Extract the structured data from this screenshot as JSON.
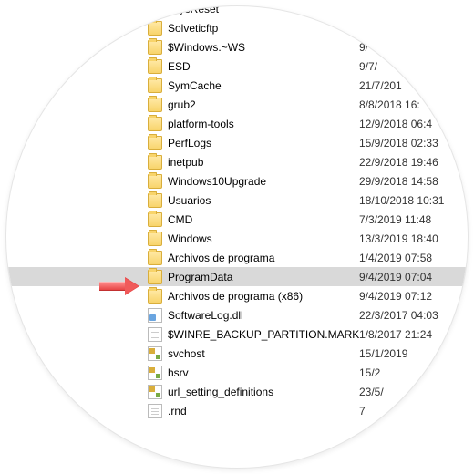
{
  "items": [
    {
      "icon": "folder",
      "name": "..sysReset",
      "date": ""
    },
    {
      "icon": "folder",
      "name": "Solveticftp",
      "date": ""
    },
    {
      "icon": "folder",
      "name": "$Windows.~WS",
      "date": "9/"
    },
    {
      "icon": "folder",
      "name": "ESD",
      "date": "9/7/"
    },
    {
      "icon": "folder",
      "name": "SymCache",
      "date": "21/7/201"
    },
    {
      "icon": "folder",
      "name": "grub2",
      "date": "8/8/2018 16:"
    },
    {
      "icon": "folder",
      "name": "platform-tools",
      "date": "12/9/2018 06:4"
    },
    {
      "icon": "folder",
      "name": "PerfLogs",
      "date": "15/9/2018 02:33"
    },
    {
      "icon": "folder",
      "name": "inetpub",
      "date": "22/9/2018 19:46"
    },
    {
      "icon": "folder",
      "name": "Windows10Upgrade",
      "date": "29/9/2018 14:58"
    },
    {
      "icon": "folder",
      "name": "Usuarios",
      "date": "18/10/2018 10:31"
    },
    {
      "icon": "folder",
      "name": "CMD",
      "date": "7/3/2019 11:48"
    },
    {
      "icon": "folder",
      "name": "Windows",
      "date": "13/3/2019 18:40"
    },
    {
      "icon": "folder",
      "name": "Archivos de programa",
      "date": "1/4/2019 07:58"
    },
    {
      "icon": "folder",
      "name": "ProgramData",
      "date": "9/4/2019 07:04",
      "selected": true
    },
    {
      "icon": "folder",
      "name": "Archivos de programa (x86)",
      "date": "9/4/2019 07:12"
    },
    {
      "icon": "dll",
      "name": "SoftwareLog.dll",
      "date": "22/3/2017 04:03"
    },
    {
      "icon": "file",
      "name": "$WINRE_BACKUP_PARTITION.MARKER",
      "date": "1/8/2017 21:24"
    },
    {
      "icon": "ini",
      "name": "svchost",
      "date": "15/1/2019"
    },
    {
      "icon": "ini",
      "name": "hsrv",
      "date": "15/2"
    },
    {
      "icon": "ini",
      "name": "url_setting_definitions",
      "date": "23/5/"
    },
    {
      "icon": "file",
      "name": ".rnd",
      "date": "7"
    }
  ]
}
